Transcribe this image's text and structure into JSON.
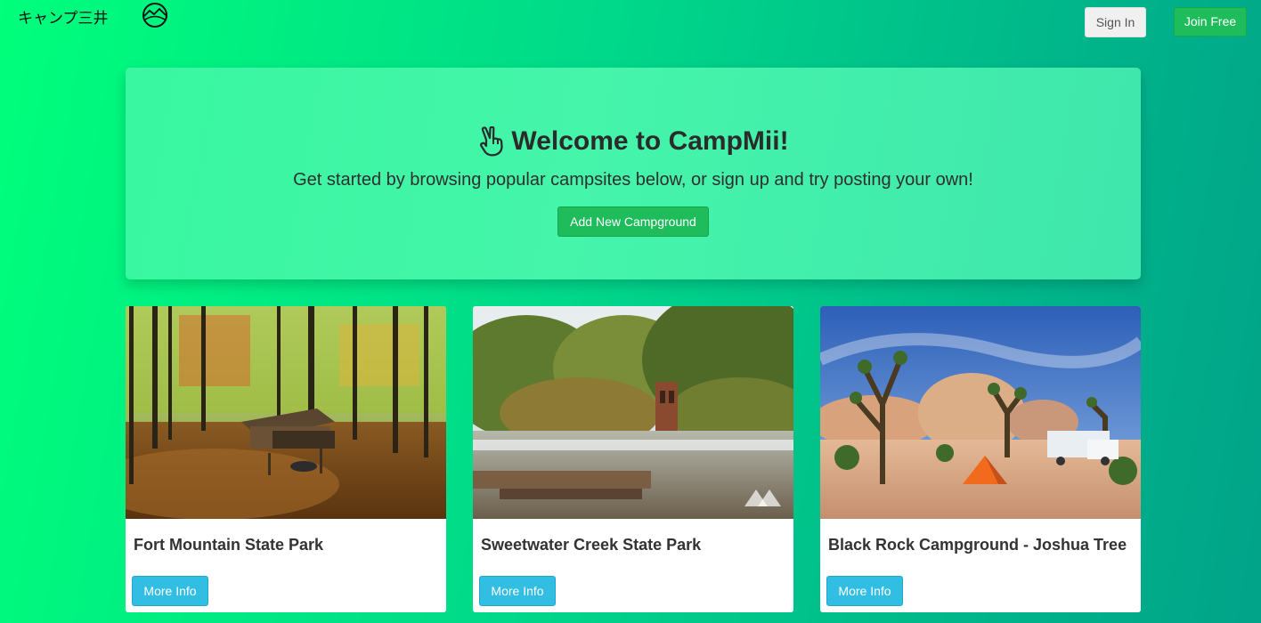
{
  "nav": {
    "brand": "キャンプ三井",
    "logo_icon": "mountain-circle-icon",
    "signin_label": "Sign In",
    "join_label": "Join Free"
  },
  "jumbotron": {
    "icon": "peace-hand-icon",
    "title": "Welcome to CampMii!",
    "subtitle": "Get started by browsing popular campsites below, or sign up and try posting your own!",
    "add_button_label": "Add New Campground"
  },
  "campgrounds": [
    {
      "name": "Fort Mountain State Park",
      "button_label": "More Info"
    },
    {
      "name": "Sweetwater Creek State Park",
      "button_label": "More Info"
    },
    {
      "name": "Black Rock Campground - Joshua Tree",
      "button_label": "More Info"
    }
  ],
  "colors": {
    "accent_green": "#1fbc5b",
    "info_blue": "#32bde3",
    "background_start": "#00ff7b",
    "background_end": "#01a389"
  }
}
